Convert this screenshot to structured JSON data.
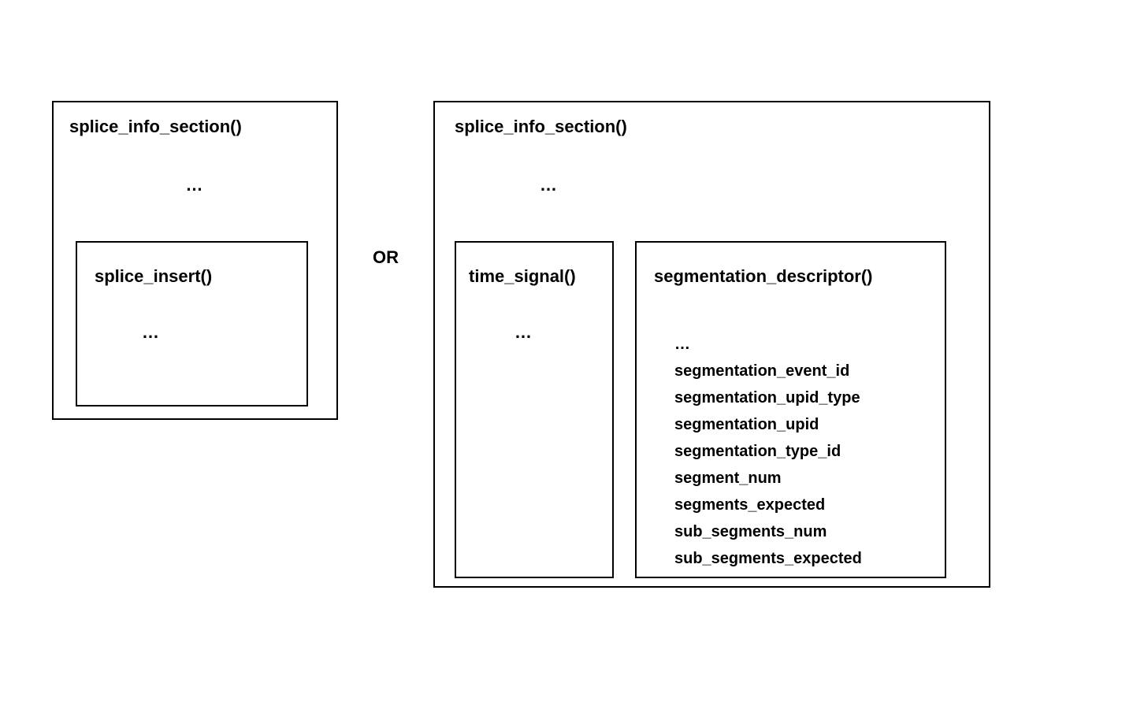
{
  "left": {
    "title": "splice_info_section()",
    "ellipsis": "…",
    "inner": {
      "title": "splice_insert()",
      "ellipsis": "…"
    }
  },
  "or_label": "OR",
  "right": {
    "title": "splice_info_section()",
    "ellipsis": "…",
    "time_signal": {
      "title": "time_signal()",
      "ellipsis": "…"
    },
    "seg_desc": {
      "title": "segmentation_descriptor()",
      "fields": {
        "f0": "…",
        "f1": "segmentation_event_id",
        "f2": "segmentation_upid_type",
        "f3": "segmentation_upid",
        "f4": "segmentation_type_id",
        "f5": "segment_num",
        "f6": "segments_expected",
        "f7": "sub_segments_num",
        "f8": "sub_segments_expected"
      }
    }
  }
}
